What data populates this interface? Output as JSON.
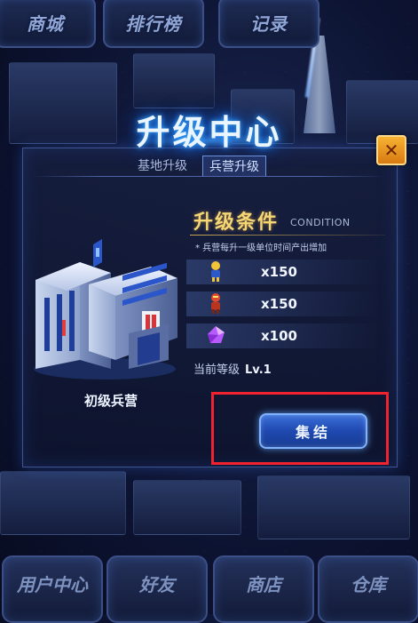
{
  "top_nav": [
    {
      "label": "商城"
    },
    {
      "label": "排行榜"
    },
    {
      "label": "记录"
    }
  ],
  "bottom_nav": [
    {
      "label": "用户中心"
    },
    {
      "label": "好友"
    },
    {
      "label": "商店"
    },
    {
      "label": "仓库"
    }
  ],
  "dialog": {
    "title": "升级中心",
    "tabs": [
      {
        "label": "基地升级",
        "active": false
      },
      {
        "label": "兵营升级",
        "active": true
      }
    ],
    "building_name": "初级兵营",
    "condition": {
      "title": "升级条件",
      "title_en": "CONDITION",
      "note": "* 兵营每升一级单位时间产出增加",
      "resources": [
        {
          "icon": "yellow-soldier-icon",
          "value": "x150"
        },
        {
          "icon": "red-soldier-icon",
          "value": "x150"
        },
        {
          "icon": "purple-crystal-icon",
          "value": "x100"
        }
      ],
      "level_label": "当前等级",
      "level_value": "Lv.1"
    },
    "action_button": "集结",
    "close_icon": "close-icon"
  },
  "colors": {
    "title_glow": "#37a9ff",
    "condition_gold": "#f5d675",
    "button_blue": "#1f49b0",
    "highlight_red": "#f0232f",
    "close_orange": "#f7b233"
  }
}
